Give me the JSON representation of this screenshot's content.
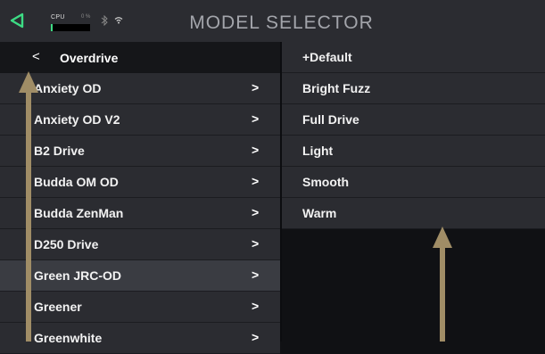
{
  "topbar": {
    "title": "MODEL SELECTOR",
    "cpu_label": "CPU",
    "cpu_percent": "0 %",
    "cpu_load_fraction": 0.0,
    "bluetooth_icon": "bluetooth-icon",
    "wifi_icon": "wifi-icon",
    "back_icon": "back-triangle-icon"
  },
  "left_panel": {
    "header": {
      "chevron": "<",
      "label": "Overdrive"
    },
    "items": [
      {
        "label": "Anxiety OD",
        "chevron": ">"
      },
      {
        "label": "Anxiety OD V2",
        "chevron": ">"
      },
      {
        "label": "B2 Drive",
        "chevron": ">"
      },
      {
        "label": "Budda OM OD",
        "chevron": ">"
      },
      {
        "label": "Budda ZenMan",
        "chevron": ">"
      },
      {
        "label": "D250 Drive",
        "chevron": ">"
      },
      {
        "label": "Green JRC-OD",
        "chevron": ">",
        "selected": true
      },
      {
        "label": "Greener",
        "chevron": ">"
      },
      {
        "label": "Greenwhite",
        "chevron": ">"
      }
    ]
  },
  "right_panel": {
    "items": [
      {
        "label": "+Default"
      },
      {
        "label": "Bright Fuzz"
      },
      {
        "label": "Full Drive"
      },
      {
        "label": "Light"
      },
      {
        "label": "Smooth"
      },
      {
        "label": "Warm"
      }
    ]
  },
  "colors": {
    "accent": "#3ddc84",
    "arrow": "#a08d66",
    "panel": "#2b2c31",
    "selected": "#3a3c42"
  }
}
